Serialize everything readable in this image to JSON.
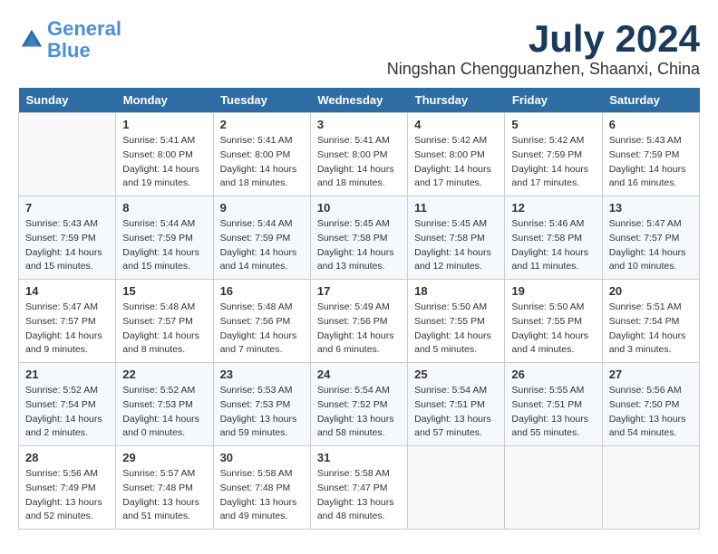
{
  "logo": {
    "line1": "General",
    "line2": "Blue"
  },
  "title": "July 2024",
  "subtitle": "Ningshan Chengguanzhen, Shaanxi, China",
  "days_header": [
    "Sunday",
    "Monday",
    "Tuesday",
    "Wednesday",
    "Thursday",
    "Friday",
    "Saturday"
  ],
  "weeks": [
    [
      {
        "num": "",
        "info": ""
      },
      {
        "num": "1",
        "info": "Sunrise: 5:41 AM\nSunset: 8:00 PM\nDaylight: 14 hours\nand 19 minutes."
      },
      {
        "num": "2",
        "info": "Sunrise: 5:41 AM\nSunset: 8:00 PM\nDaylight: 14 hours\nand 18 minutes."
      },
      {
        "num": "3",
        "info": "Sunrise: 5:41 AM\nSunset: 8:00 PM\nDaylight: 14 hours\nand 18 minutes."
      },
      {
        "num": "4",
        "info": "Sunrise: 5:42 AM\nSunset: 8:00 PM\nDaylight: 14 hours\nand 17 minutes."
      },
      {
        "num": "5",
        "info": "Sunrise: 5:42 AM\nSunset: 7:59 PM\nDaylight: 14 hours\nand 17 minutes."
      },
      {
        "num": "6",
        "info": "Sunrise: 5:43 AM\nSunset: 7:59 PM\nDaylight: 14 hours\nand 16 minutes."
      }
    ],
    [
      {
        "num": "7",
        "info": "Sunrise: 5:43 AM\nSunset: 7:59 PM\nDaylight: 14 hours\nand 15 minutes."
      },
      {
        "num": "8",
        "info": "Sunrise: 5:44 AM\nSunset: 7:59 PM\nDaylight: 14 hours\nand 15 minutes."
      },
      {
        "num": "9",
        "info": "Sunrise: 5:44 AM\nSunset: 7:59 PM\nDaylight: 14 hours\nand 14 minutes."
      },
      {
        "num": "10",
        "info": "Sunrise: 5:45 AM\nSunset: 7:58 PM\nDaylight: 14 hours\nand 13 minutes."
      },
      {
        "num": "11",
        "info": "Sunrise: 5:45 AM\nSunset: 7:58 PM\nDaylight: 14 hours\nand 12 minutes."
      },
      {
        "num": "12",
        "info": "Sunrise: 5:46 AM\nSunset: 7:58 PM\nDaylight: 14 hours\nand 11 minutes."
      },
      {
        "num": "13",
        "info": "Sunrise: 5:47 AM\nSunset: 7:57 PM\nDaylight: 14 hours\nand 10 minutes."
      }
    ],
    [
      {
        "num": "14",
        "info": "Sunrise: 5:47 AM\nSunset: 7:57 PM\nDaylight: 14 hours\nand 9 minutes."
      },
      {
        "num": "15",
        "info": "Sunrise: 5:48 AM\nSunset: 7:57 PM\nDaylight: 14 hours\nand 8 minutes."
      },
      {
        "num": "16",
        "info": "Sunrise: 5:48 AM\nSunset: 7:56 PM\nDaylight: 14 hours\nand 7 minutes."
      },
      {
        "num": "17",
        "info": "Sunrise: 5:49 AM\nSunset: 7:56 PM\nDaylight: 14 hours\nand 6 minutes."
      },
      {
        "num": "18",
        "info": "Sunrise: 5:50 AM\nSunset: 7:55 PM\nDaylight: 14 hours\nand 5 minutes."
      },
      {
        "num": "19",
        "info": "Sunrise: 5:50 AM\nSunset: 7:55 PM\nDaylight: 14 hours\nand 4 minutes."
      },
      {
        "num": "20",
        "info": "Sunrise: 5:51 AM\nSunset: 7:54 PM\nDaylight: 14 hours\nand 3 minutes."
      }
    ],
    [
      {
        "num": "21",
        "info": "Sunrise: 5:52 AM\nSunset: 7:54 PM\nDaylight: 14 hours\nand 2 minutes."
      },
      {
        "num": "22",
        "info": "Sunrise: 5:52 AM\nSunset: 7:53 PM\nDaylight: 14 hours\nand 0 minutes."
      },
      {
        "num": "23",
        "info": "Sunrise: 5:53 AM\nSunset: 7:53 PM\nDaylight: 13 hours\nand 59 minutes."
      },
      {
        "num": "24",
        "info": "Sunrise: 5:54 AM\nSunset: 7:52 PM\nDaylight: 13 hours\nand 58 minutes."
      },
      {
        "num": "25",
        "info": "Sunrise: 5:54 AM\nSunset: 7:51 PM\nDaylight: 13 hours\nand 57 minutes."
      },
      {
        "num": "26",
        "info": "Sunrise: 5:55 AM\nSunset: 7:51 PM\nDaylight: 13 hours\nand 55 minutes."
      },
      {
        "num": "27",
        "info": "Sunrise: 5:56 AM\nSunset: 7:50 PM\nDaylight: 13 hours\nand 54 minutes."
      }
    ],
    [
      {
        "num": "28",
        "info": "Sunrise: 5:56 AM\nSunset: 7:49 PM\nDaylight: 13 hours\nand 52 minutes."
      },
      {
        "num": "29",
        "info": "Sunrise: 5:57 AM\nSunset: 7:48 PM\nDaylight: 13 hours\nand 51 minutes."
      },
      {
        "num": "30",
        "info": "Sunrise: 5:58 AM\nSunset: 7:48 PM\nDaylight: 13 hours\nand 49 minutes."
      },
      {
        "num": "31",
        "info": "Sunrise: 5:58 AM\nSunset: 7:47 PM\nDaylight: 13 hours\nand 48 minutes."
      },
      {
        "num": "",
        "info": ""
      },
      {
        "num": "",
        "info": ""
      },
      {
        "num": "",
        "info": ""
      }
    ]
  ]
}
